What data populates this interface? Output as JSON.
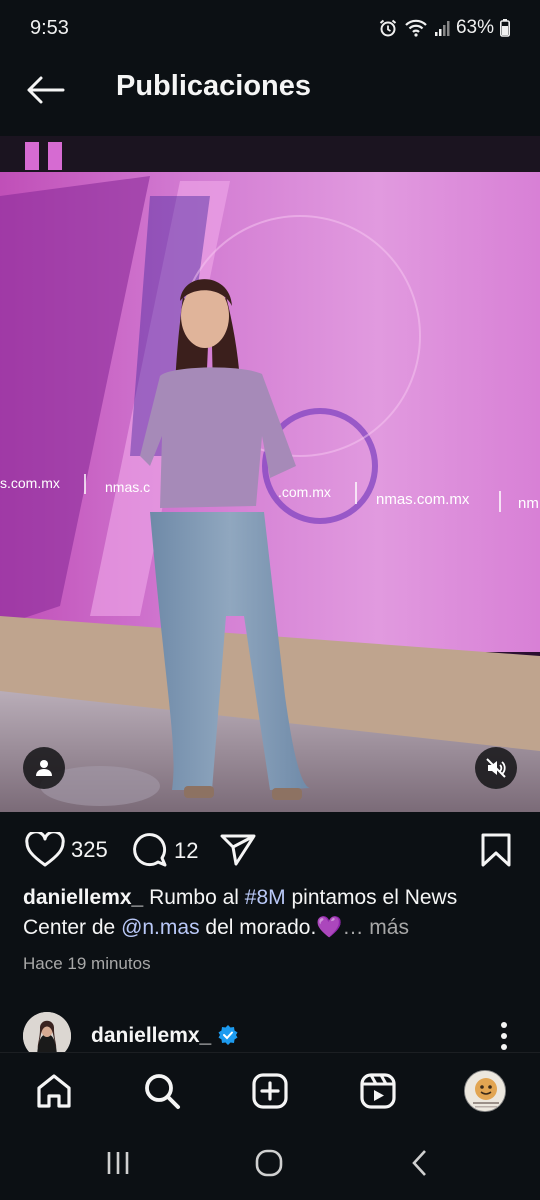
{
  "status_bar": {
    "time": "9:53",
    "battery": "63%",
    "icons": [
      "alarm-icon",
      "wifi-icon",
      "signal-icon",
      "battery-icon"
    ]
  },
  "header": {
    "title": "Publicaciones",
    "back_icon": "arrow-left-icon"
  },
  "post": {
    "image_signage": [
      "s.com.mx",
      "nmas.c",
      ".com.mx",
      "nmas.com.mx",
      "nm"
    ],
    "tag_icon": "person-icon",
    "mute_icon": "speaker-muted-icon",
    "likes": "325",
    "comments": "12",
    "caption": {
      "username": "daniellemx_",
      "text_1": " Rumbo al ",
      "hashtag": "#8M",
      "text_2": " pintamos el News Center de ",
      "mention": "@n.mas",
      "text_3": " del morado.💜",
      "more": "… más"
    },
    "time_ago": "Hace 19 minutos"
  },
  "next_post": {
    "username": "daniellemx_",
    "verified": true
  },
  "bottom_nav": {
    "items": [
      "home-icon",
      "search-icon",
      "create-icon",
      "reels-icon",
      "profile-avatar"
    ]
  },
  "colors": {
    "background": "#0c1014",
    "link": "#b9c8f7",
    "verified": "#1d9bf0",
    "muted_text": "#a8a8a8"
  }
}
